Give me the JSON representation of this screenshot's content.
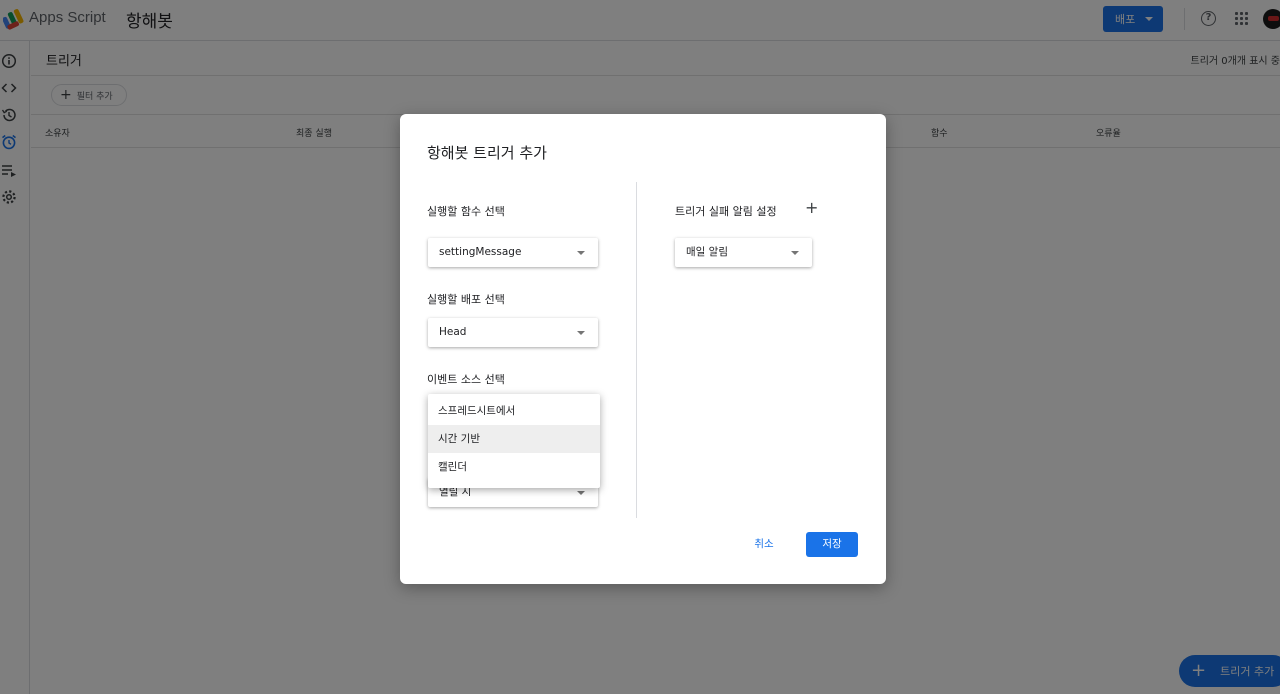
{
  "app": {
    "name": "Apps Script",
    "project": "항해봇",
    "deploy_label": "배포"
  },
  "sidebar": {
    "items": [
      "info-icon",
      "code-icon",
      "history-icon",
      "alarm-icon",
      "executions-icon",
      "settings-icon"
    ]
  },
  "triggers_page": {
    "title": "트리거",
    "count_text": "트리거 0개개 표시 중",
    "filter_label": "필터 추가",
    "columns": [
      "소유자",
      "최종 실행",
      "함수",
      "오류율"
    ],
    "add_button": "트리거 추가"
  },
  "dialog": {
    "title": "항해봇 트리거 추가",
    "function_label": "실행할 함수 선택",
    "function_value": "settingMessage",
    "deployment_label": "실행할 배포 선택",
    "deployment_value": "Head",
    "event_source_label": "이벤트 소스 선택",
    "event_source_options": [
      "스프레드시트에서",
      "시간 기반",
      "캘린더"
    ],
    "event_source_highlighted": "시간 기반",
    "event_type_value": "열릴 시",
    "notify_label": "트리거 실패 알림 설정",
    "notify_value": "매일 알림",
    "cancel_label": "취소",
    "save_label": "저장"
  },
  "colors": {
    "primary": "#1a73e8",
    "scrim": "rgba(0,0,0,0.5)"
  }
}
